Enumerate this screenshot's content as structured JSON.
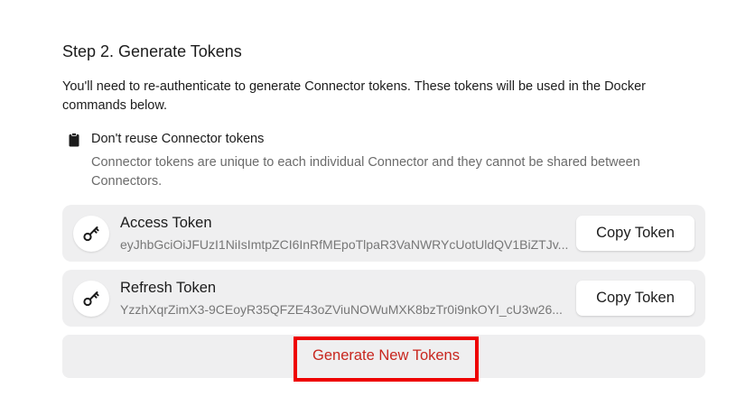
{
  "step": {
    "title": "Step 2. Generate Tokens",
    "description": "You'll need to re-authenticate to generate Connector tokens. These tokens will be used in the Docker commands below."
  },
  "notice": {
    "icon": "clipboard-icon",
    "title": "Don't reuse Connector tokens",
    "body": "Connector tokens are unique to each individual Connector and they cannot be shared between Connectors."
  },
  "tokens": [
    {
      "icon": "key-icon",
      "label": "Access Token",
      "value": "eyJhbGciOiJFUzI1NiIsImtpZCI6InRfMEpoTlpaR3VaNWRYcUotUldQV1BiZTJv...",
      "copy_label": "Copy Token"
    },
    {
      "icon": "key-icon",
      "label": "Refresh Token",
      "value": "YzzhXqrZimX3-9CEoyR35QFZE43oZViuNOWuMXK8bzTr0i9nkOYI_cU3w26...",
      "copy_label": "Copy Token"
    }
  ],
  "generate": {
    "label": "Generate New Tokens",
    "highlight_color": "#ee0000",
    "text_color": "#c8261e"
  }
}
